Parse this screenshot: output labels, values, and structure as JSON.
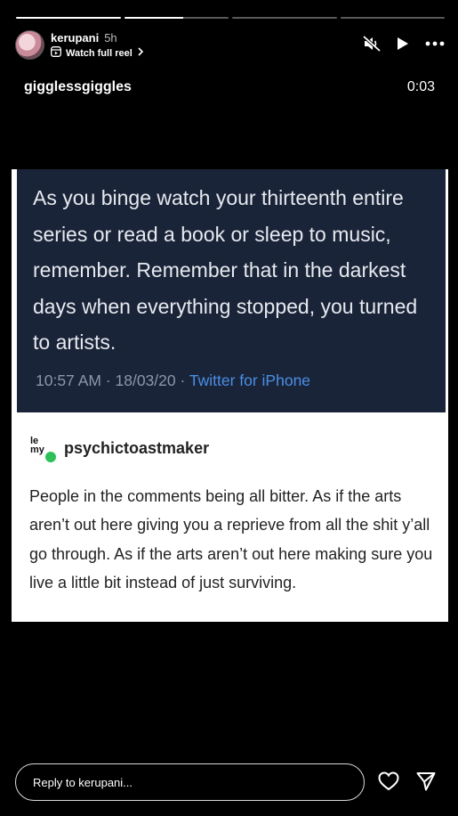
{
  "story": {
    "segments": [
      1,
      1,
      0,
      0
    ],
    "username": "kerupani",
    "posted": "5h",
    "watch_full_reel": "Watch full reel",
    "caption_user": "gigglessgiggles",
    "timer": "0:03"
  },
  "media": {
    "tweet": {
      "text": "As you binge watch your thirteenth entire series or read a book or sleep to music, remember. Remember that in the darkest days when everything stopped, you turned to artists.",
      "timestamp": "10:57 AM · 18/03/20 · ",
      "source": "Twitter for iPhone"
    },
    "tumblr": {
      "avatar_text": "le my",
      "blog_name": "psychictoastmaker",
      "text": "People in the comments being all bitter. As if the arts aren’t out here giving you a reprieve from all the shit y’all go through. As if the arts aren’t out here making sure you live a little bit instead of just surviving."
    }
  },
  "reply": {
    "placeholder": "Reply to kerupani..."
  },
  "icons": [
    "muted-speaker-icon",
    "play-icon",
    "more-icon",
    "reel-icon",
    "chevron-right-icon",
    "heart-icon",
    "send-icon"
  ]
}
